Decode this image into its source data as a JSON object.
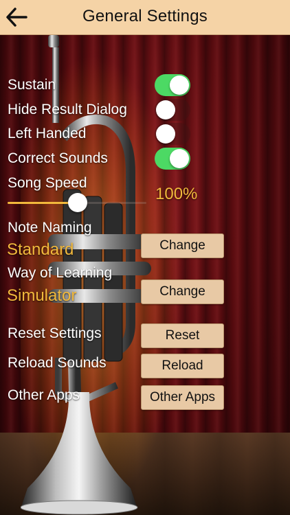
{
  "header": {
    "title": "General Settings",
    "back_icon": "arrow-left-icon"
  },
  "settings": {
    "sustain": {
      "label": "Sustain",
      "on": true
    },
    "hide_result_dialog": {
      "label": "Hide Result Dialog",
      "on": false
    },
    "left_handed": {
      "label": "Left Handed",
      "on": false
    },
    "correct_sounds": {
      "label": "Correct Sounds",
      "on": true
    },
    "song_speed": {
      "label": "Song Speed",
      "value": "100%",
      "fraction": 0.5
    },
    "note_naming": {
      "label": "Note Naming",
      "value": "Standard",
      "button": "Change"
    },
    "way_of_learning": {
      "label": "Way of Learning",
      "value": "Simulator",
      "button": "Change"
    },
    "reset_settings": {
      "label": "Reset Settings",
      "button": "Reset"
    },
    "reload_sounds": {
      "label": "Reload Sounds",
      "button": "Reload"
    },
    "other_apps": {
      "label": "Other Apps",
      "button": "Other Apps"
    }
  },
  "colors": {
    "accent": "#f2b93c",
    "switch_on": "#4cd964",
    "header_bg": "#f5d3a6",
    "button_bg": "#e8c9a5"
  }
}
